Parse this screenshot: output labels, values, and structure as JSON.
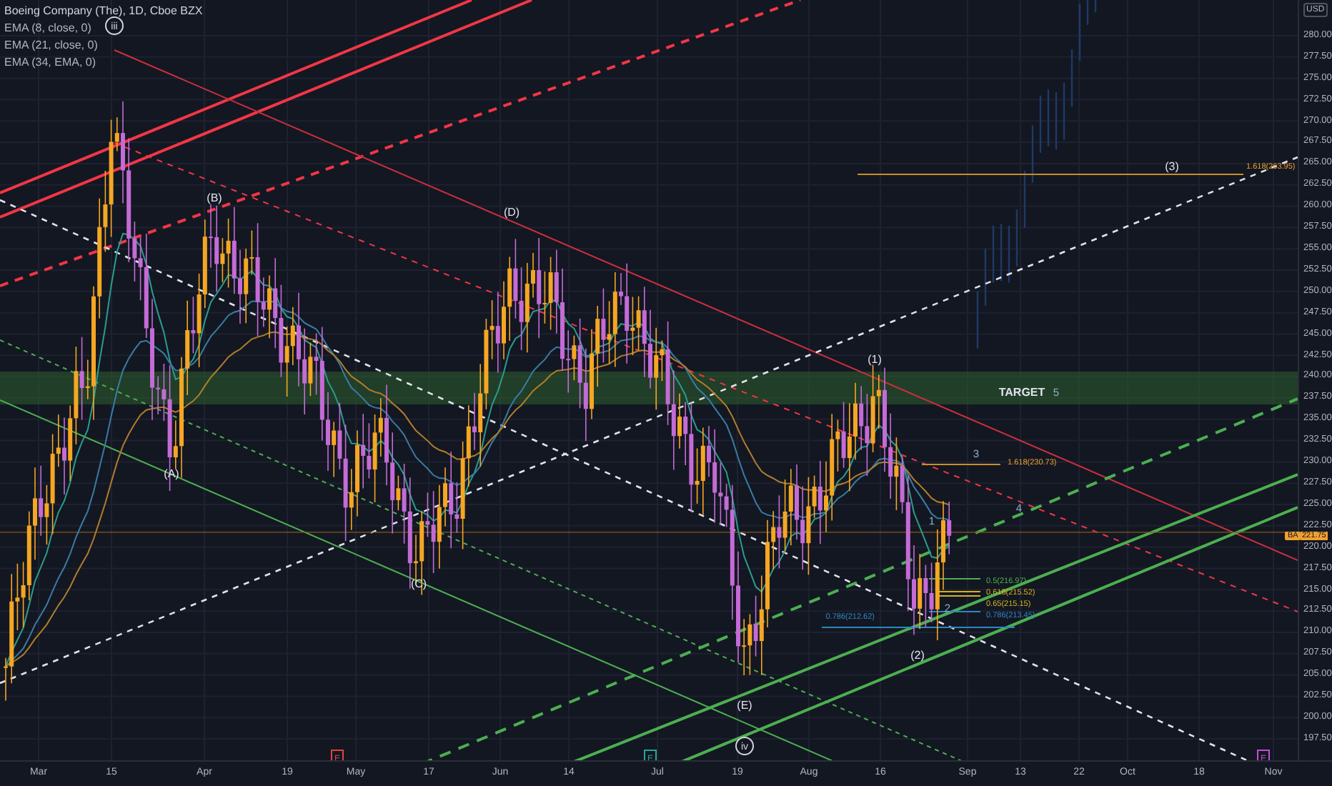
{
  "legend": {
    "symbol": "Boeing Company (The), 1D, Cboe BZX",
    "indicators": [
      "EMA (8, close, 0)",
      "EMA (21, close, 0)",
      "EMA (34, EMA, 0)"
    ]
  },
  "price_axis": {
    "currency": "USD",
    "labels": [
      "280.00",
      "277.50",
      "275.00",
      "272.50",
      "270.00",
      "267.50",
      "265.00",
      "262.50",
      "260.00",
      "257.50",
      "255.00",
      "252.50",
      "250.00",
      "247.50",
      "245.00",
      "242.50",
      "240.00",
      "237.50",
      "235.00",
      "232.50",
      "230.00",
      "227.50",
      "225.00",
      "222.50",
      "220.00",
      "217.50",
      "215.00",
      "212.50",
      "210.00",
      "207.50",
      "205.00",
      "202.50",
      "200.00",
      "197.50"
    ],
    "last_price": {
      "symbol": "BA",
      "value": "221.75"
    }
  },
  "time_axis": {
    "labels": [
      "Mar",
      "15",
      "Apr",
      "19",
      "May",
      "17",
      "Jun",
      "14",
      "Jul",
      "19",
      "Aug",
      "16",
      "Sep",
      "13",
      "22",
      "Oct",
      "18",
      "Nov"
    ]
  },
  "annotations": [
    {
      "kind": "circled",
      "text": "iii"
    },
    {
      "kind": "wave",
      "text": "(B)"
    },
    {
      "kind": "wave",
      "text": "(A)"
    },
    {
      "kind": "wave",
      "text": "(D)"
    },
    {
      "kind": "wave",
      "text": "(C)"
    },
    {
      "kind": "wave",
      "text": "(E)"
    },
    {
      "kind": "circled",
      "text": "iv"
    },
    {
      "kind": "wave",
      "text": "(1)"
    },
    {
      "kind": "wave",
      "text": "(2)"
    },
    {
      "kind": "wave",
      "text": "(3)"
    },
    {
      "kind": "target",
      "text": "TARGET"
    },
    {
      "kind": "count",
      "text": "5"
    },
    {
      "kind": "count",
      "text": "3"
    },
    {
      "kind": "count",
      "text": "4"
    },
    {
      "kind": "count",
      "text": "1"
    },
    {
      "kind": "count",
      "text": "2"
    }
  ],
  "fib_levels": [
    {
      "text": "1.618(263.95)",
      "color": "#f0a030"
    },
    {
      "text": "1.618(230.73)",
      "color": "#f0a030"
    },
    {
      "text": "0.5(216.97)",
      "color": "#4caf50"
    },
    {
      "text": "0.618(215.52)",
      "color": "#d4b020"
    },
    {
      "text": "0.65(215.15)",
      "color": "#d4b020"
    },
    {
      "text": "0.786(212.62)",
      "color": "#2e86c1"
    },
    {
      "text": "0.786(213.45)",
      "color": "#2e86c1"
    }
  ],
  "event_flags": [
    {
      "text": "E",
      "color": "#e0463c"
    },
    {
      "text": "E",
      "color": "#26a69a"
    },
    {
      "text": "E",
      "color": "#c04fd8"
    }
  ]
}
